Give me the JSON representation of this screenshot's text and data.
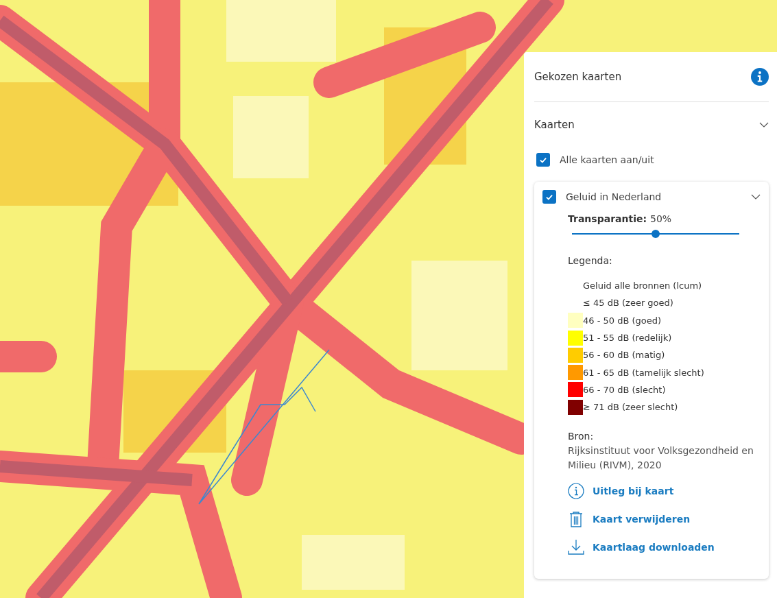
{
  "panel": {
    "title": "Gekozen kaarten",
    "section": {
      "title": "Kaarten",
      "expanded": true
    },
    "toggle_all": {
      "label": "Alle kaarten aan/uit",
      "checked": true
    },
    "layers": [
      {
        "name": "Geluid in Nederland",
        "checked": true,
        "expanded": true,
        "transparency": {
          "label": "Transparantie:",
          "reading": "50%",
          "level": 0.5
        },
        "legend": {
          "title": "Legenda:",
          "heading": "Geluid alle bronnen (lcum)",
          "items": [
            {
              "label": "≤ 45 dB (zeer goed)"
            },
            {
              "label": "46 - 50 dB (goed)",
              "color": "#ffffc0"
            },
            {
              "label": "51 - 55 dB (redelijk)",
              "color": "#ffff00"
            },
            {
              "label": "56 - 60 dB (matig)",
              "color": "#ffcc00"
            },
            {
              "label": "61 - 65 dB (tamelijk slecht)",
              "color": "#ff9900"
            },
            {
              "label": "66 - 70 dB (slecht)",
              "color": "#ff0000"
            },
            {
              "label": "≥ 71 dB (zeer slecht)",
              "color": "#800000"
            }
          ]
        },
        "source": {
          "title": "Bron:",
          "text": "Rijksinstituut voor Volksgezondheid en Milieu (RIVM), 2020"
        },
        "actions": [
          {
            "kind": "info",
            "label": "Uitleg bij kaart"
          },
          {
            "kind": "delete",
            "label": "Kaart verwijderen"
          },
          {
            "kind": "download",
            "label": "Kaartlaag downloaden"
          }
        ]
      }
    ]
  }
}
